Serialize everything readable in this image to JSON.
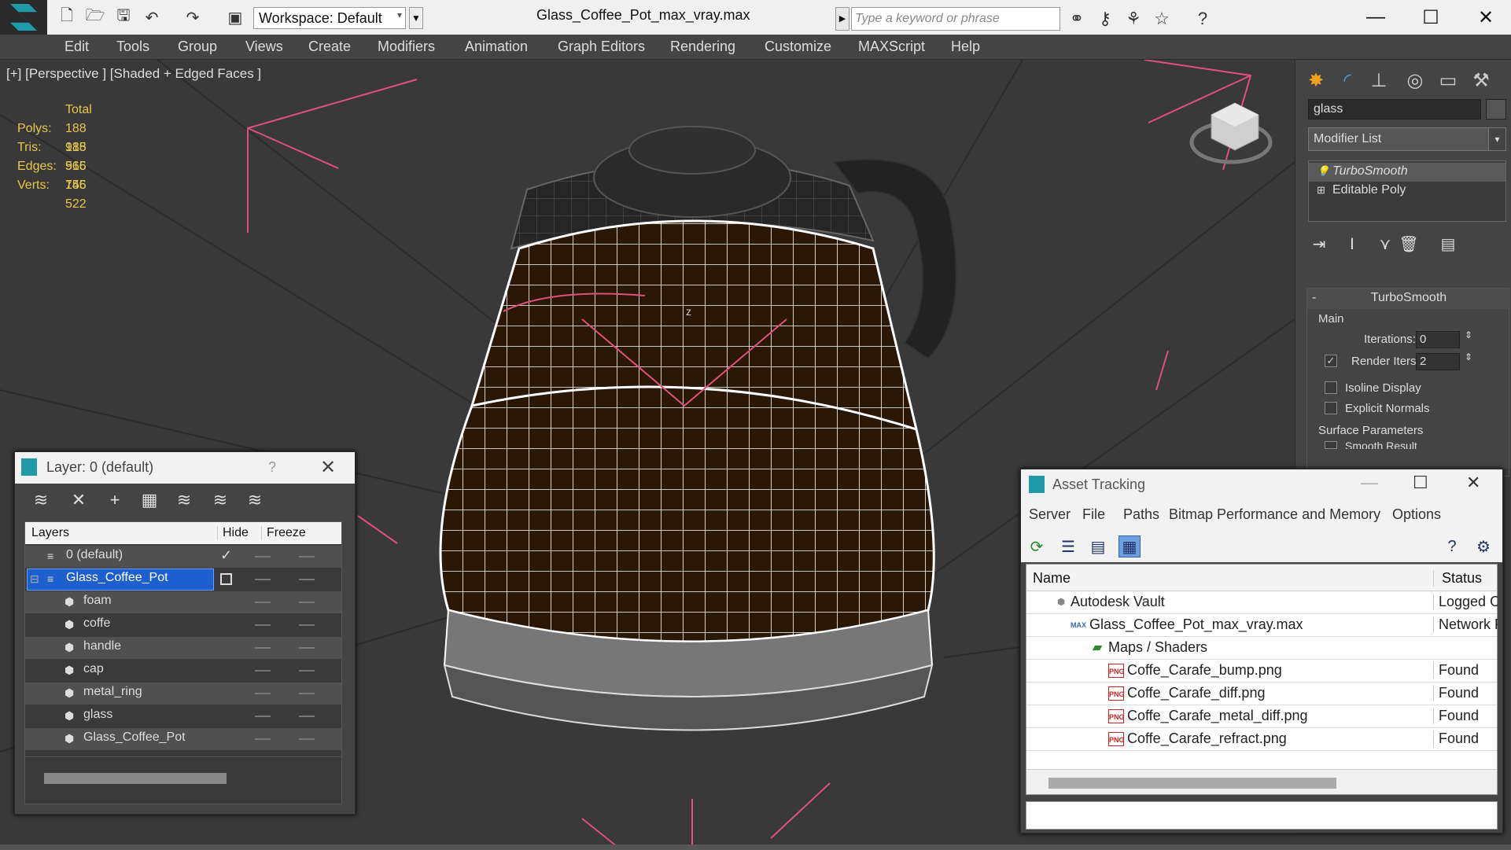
{
  "titlebar": {
    "workspace_label": "Workspace: Default",
    "document_title": "Glass_Coffee_Pot_max_vray.max",
    "search_placeholder": "Type a keyword or phrase"
  },
  "menu": [
    "Edit",
    "Tools",
    "Group",
    "Views",
    "Create",
    "Modifiers",
    "Animation",
    "Graph Editors",
    "Rendering",
    "Customize",
    "MAXScript",
    "Help"
  ],
  "viewport": {
    "label": "[+] [Perspective ] [Shaded + Edged Faces ]",
    "stats": {
      "header": "Total",
      "rows": [
        {
          "key": "Polys:",
          "value": "188 915"
        },
        {
          "key": "Tris:",
          "value": "188 915"
        },
        {
          "key": "Edges:",
          "value": "566 745"
        },
        {
          "key": "Verts:",
          "value": "156 522"
        }
      ]
    },
    "axis_label": "z"
  },
  "command_panel": {
    "object_name": "glass",
    "modifier_list": "Modifier List",
    "stack": [
      "TurboSmooth",
      "Editable Poly"
    ],
    "rollout_title": "TurboSmooth",
    "main_label": "Main",
    "iterations_label": "Iterations:",
    "iterations_value": "0",
    "render_iters_label": "Render Iters:",
    "render_iters_value": "2",
    "isoline_label": "Isoline Display",
    "explicit_normals_label": "Explicit Normals",
    "surface_params_label": "Surface Parameters",
    "smooth_result_label": "Smooth Result"
  },
  "layer_window": {
    "title": "Layer: 0 (default)",
    "help": "?",
    "columns": [
      "Layers",
      "Hide",
      "Freeze"
    ],
    "rows": [
      {
        "name": "0 (default)",
        "level": 0,
        "checked": true
      },
      {
        "name": "Glass_Coffee_Pot",
        "level": 0,
        "selected": true
      },
      {
        "name": "foam",
        "level": 1
      },
      {
        "name": "coffe",
        "level": 1
      },
      {
        "name": "handle",
        "level": 1
      },
      {
        "name": "cap",
        "level": 1
      },
      {
        "name": "metal_ring",
        "level": 1
      },
      {
        "name": "glass",
        "level": 1
      },
      {
        "name": "Glass_Coffee_Pot",
        "level": 1
      }
    ]
  },
  "asset_window": {
    "title": "Asset Tracking",
    "menu": [
      "Server",
      "File",
      "Paths",
      "Bitmap Performance and Memory",
      "Options"
    ],
    "columns": [
      "Name",
      "Status"
    ],
    "rows": [
      {
        "name": "Autodesk Vault",
        "status": "Logged Out",
        "indent": 0,
        "icon": "vault-icon"
      },
      {
        "name": "Glass_Coffee_Pot_max_vray.max",
        "status": "Network Path",
        "indent": 1,
        "icon": "max-file-icon"
      },
      {
        "name": "Maps / Shaders",
        "status": "",
        "indent": 2,
        "icon": "maps-icon"
      },
      {
        "name": "Coffe_Carafe_bump.png",
        "status": "Found",
        "indent": 3,
        "icon": "png-icon"
      },
      {
        "name": "Coffe_Carafe_diff.png",
        "status": "Found",
        "indent": 3,
        "icon": "png-icon"
      },
      {
        "name": "Coffe_Carafe_metal_diff.png",
        "status": "Found",
        "indent": 3,
        "icon": "png-icon"
      },
      {
        "name": "Coffe_Carafe_refract.png",
        "status": "Found",
        "indent": 3,
        "icon": "png-icon"
      }
    ]
  },
  "colors": {
    "accent": "#1f9aa8",
    "selection": "#1e5fcf",
    "stats_text": "#e6c84a",
    "wire": "#ffffff",
    "light_lines": "#e0507a",
    "coffee": "#2a1706"
  }
}
